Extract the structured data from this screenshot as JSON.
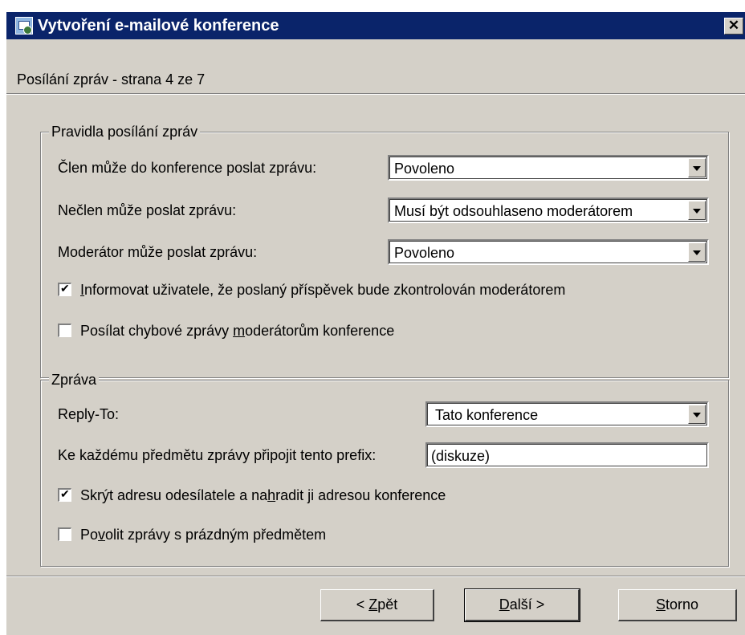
{
  "window": {
    "title": "Vytvoření e-mailové konference",
    "close_glyph": "✕",
    "subtitle": "Posílání zpráv - strana 4 ze 7"
  },
  "rules_group": {
    "title": "Pravidla posílání zpráv",
    "member_send": {
      "label": "Člen může do konference poslat zprávu:",
      "value": "Povoleno"
    },
    "nonmember_send": {
      "label": "Nečlen může poslat zprávu:",
      "value": "Musí být odsouhlaseno moderátorem"
    },
    "moderator_send": {
      "label": "Moderátor může poslat zprávu:",
      "value": "Povoleno"
    },
    "inform_user": {
      "checked": true,
      "mnemonic": "I",
      "rest": "nformovat uživatele, že poslaný příspěvek bude zkontrolován moderátorem"
    },
    "send_errors": {
      "checked": false,
      "before": "Posílat chybové zprávy ",
      "mnemonic": "m",
      "after": "oderátorům konference"
    }
  },
  "message_group": {
    "title": "Zpráva",
    "reply_to": {
      "label": "Reply-To:",
      "value": "Tato konference"
    },
    "prefix": {
      "label": "Ke každému předmětu zprávy připojit tento prefix:",
      "value": "(diskuze)"
    },
    "hide_sender": {
      "checked": true,
      "before": "Skrýt adresu odesílatele a na",
      "mnemonic": "h",
      "after": "radit ji adresou konference"
    },
    "allow_empty": {
      "checked": false,
      "before": "Po",
      "mnemonic": "v",
      "after": "olit zprávy s prázdným předmětem"
    }
  },
  "buttons": {
    "back": {
      "before": "< ",
      "mnemonic": "Z",
      "after": "pět"
    },
    "next": {
      "mnemonic": "D",
      "after": "alší >"
    },
    "cancel": {
      "mnemonic": "S",
      "after": "torno"
    }
  },
  "icons": {
    "app": "mail-list-icon",
    "close": "close-icon",
    "dropdown": "dropdown-arrow-icon",
    "checkmark": "checkmark-icon"
  },
  "colors": {
    "titlebar": "#0a246a",
    "dialog_face": "#d4d0c8",
    "field_bg": "#ffffff"
  }
}
